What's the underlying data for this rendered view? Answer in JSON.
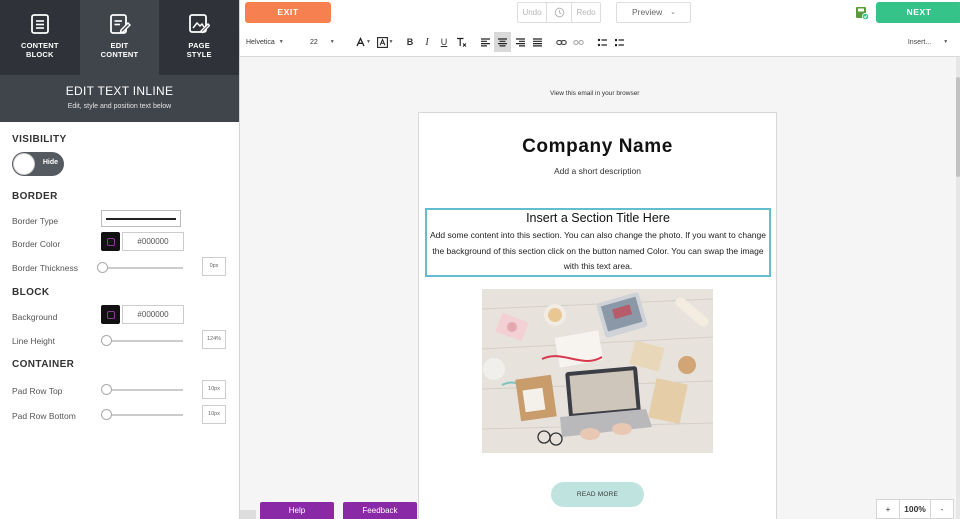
{
  "sidebar": {
    "tabs": [
      {
        "label": "CONTENT\nBLOCK",
        "icon": "content-block-icon"
      },
      {
        "label": "EDIT\nCONTENT",
        "icon": "edit-content-icon"
      },
      {
        "label": "PAGE\nSTYLE",
        "icon": "page-style-icon"
      }
    ],
    "panel_title": "EDIT TEXT INLINE",
    "panel_subtitle": "Edit, style and position text below",
    "visibility": {
      "title": "VISIBILITY",
      "toggle_label": "Hide"
    },
    "border": {
      "title": "BORDER",
      "type_label": "Border Type",
      "color_label": "Border Color",
      "color_value": "#000000",
      "thickness_label": "Border Thickness",
      "thickness_value": "0px"
    },
    "block": {
      "title": "BLOCK",
      "background_label": "Background",
      "background_value": "#000000",
      "line_height_label": "Line Height",
      "line_height_value": "124%"
    },
    "container": {
      "title": "CONTAINER",
      "pad_top_label": "Pad Row Top",
      "pad_top_value": "10px",
      "pad_bottom_label": "Pad Row Bottom",
      "pad_bottom_value": "10px"
    }
  },
  "topbar": {
    "exit_label": "EXIT",
    "undo_label": "Undo",
    "redo_label": "Redo",
    "preview_label": "Preview",
    "next_label": "NEXT"
  },
  "toolbar": {
    "font_family": "Helvetica",
    "font_size": "22",
    "insert_label": "Insert..."
  },
  "email": {
    "browser_link": "View this email in your browser",
    "company_name": "Company Name",
    "description": "Add a short description",
    "section_title": "Insert a Section Title Here",
    "section_body": "Add some content into this section. You can also change the photo. If you want to change the background of this section click on the button named Color. You can swap the image with this text area.",
    "read_more": "READ MORE"
  },
  "footer": {
    "help_label": "Help",
    "feedback_label": "Feedback",
    "zoom_in": "+",
    "zoom_value": "100%",
    "zoom_out": "-"
  },
  "colors": {
    "exit": "#f6804f",
    "next": "#36c38a",
    "help": "#8a29a6",
    "selected_outline": "#64bcd0",
    "read_more_bg": "#bfe3df",
    "sidebar_dark": "#2f3238"
  }
}
